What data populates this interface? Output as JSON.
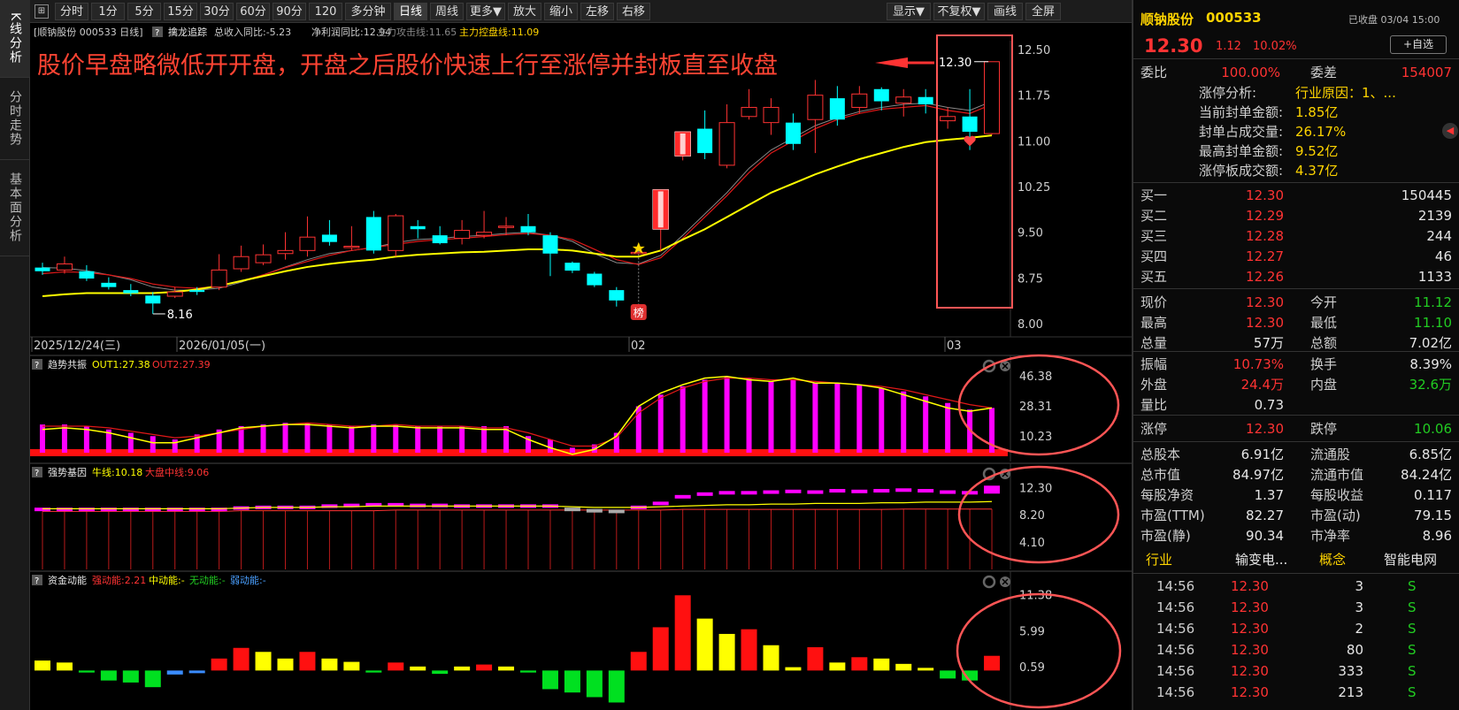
{
  "leftnav": [
    "K线分析",
    "分时走势",
    "基本面分析"
  ],
  "toolbar": {
    "buttons": [
      "分时",
      "1分",
      "5分",
      "15分",
      "30分",
      "60分",
      "90分",
      "120分",
      "多分钟",
      "日线",
      "周线",
      "更多▼",
      "放大",
      "缩小",
      "左移",
      "右移"
    ],
    "active": "日线",
    "right_buttons": [
      "显示▼",
      "不复权▼",
      "画线",
      "全屏"
    ]
  },
  "main_chart": {
    "info": {
      "stock": "[顺钠股份 000533 日线]",
      "help": "?",
      "indicator_name": "擒龙追踪",
      "item1": "总收入同比:-5.23",
      "item2": "净利润同比:12.94",
      "item3": "主力攻击线:11.65",
      "item4": "主力控盘线:11.09"
    },
    "annotation": "股价早盘略微低开开盘，开盘之后股价快速上行至涨停并封板直至收盘",
    "high_label": "12.30",
    "low_label": "8.16",
    "bang_label": "榜",
    "price_axis": [
      "12.50",
      "11.75",
      "11.00",
      "10.25",
      "9.50",
      "8.75",
      "8.00"
    ],
    "date_axis": [
      "2025/12/24(三)",
      "2026/01/05(一)",
      "02",
      "03"
    ]
  },
  "chart_data": [
    {
      "type": "candlestick",
      "title": "顺钠股份 000533 日线",
      "y_range": [
        8.0,
        12.5
      ],
      "candles": [
        {
          "o": 8.92,
          "c": 8.86,
          "h": 9.0,
          "l": 8.8
        },
        {
          "o": 8.88,
          "c": 8.98,
          "h": 9.1,
          "l": 8.82
        },
        {
          "o": 8.86,
          "c": 8.74,
          "h": 8.96,
          "l": 8.7
        },
        {
          "o": 8.67,
          "c": 8.6,
          "h": 8.76,
          "l": 8.56
        },
        {
          "o": 8.55,
          "c": 8.5,
          "h": 8.65,
          "l": 8.45
        },
        {
          "o": 8.46,
          "c": 8.33,
          "h": 8.52,
          "l": 8.16
        },
        {
          "o": 8.45,
          "c": 8.52,
          "h": 8.6,
          "l": 8.42
        },
        {
          "o": 8.55,
          "c": 8.52,
          "h": 8.6,
          "l": 8.47
        },
        {
          "o": 8.6,
          "c": 8.88,
          "h": 9.14,
          "l": 8.55
        },
        {
          "o": 8.9,
          "c": 9.1,
          "h": 9.28,
          "l": 8.85
        },
        {
          "o": 9.0,
          "c": 9.13,
          "h": 9.3,
          "l": 8.96
        },
        {
          "o": 9.15,
          "c": 9.2,
          "h": 9.5,
          "l": 9.05
        },
        {
          "o": 9.2,
          "c": 9.42,
          "h": 9.76,
          "l": 9.1
        },
        {
          "o": 9.46,
          "c": 9.34,
          "h": 9.7,
          "l": 9.28
        },
        {
          "o": 9.25,
          "c": 9.27,
          "h": 9.6,
          "l": 9.2
        },
        {
          "o": 9.75,
          "c": 9.2,
          "h": 9.85,
          "l": 9.15
        },
        {
          "o": 9.2,
          "c": 9.77,
          "h": 9.8,
          "l": 9.1
        },
        {
          "o": 9.6,
          "c": 9.55,
          "h": 9.7,
          "l": 9.4
        },
        {
          "o": 9.45,
          "c": 9.32,
          "h": 9.6,
          "l": 9.3
        },
        {
          "o": 9.4,
          "c": 9.53,
          "h": 9.7,
          "l": 9.3
        },
        {
          "o": 9.45,
          "c": 9.5,
          "h": 9.85,
          "l": 9.4
        },
        {
          "o": 9.58,
          "c": 9.6,
          "h": 9.75,
          "l": 9.45
        },
        {
          "o": 9.6,
          "c": 9.5,
          "h": 9.8,
          "l": 9.45
        },
        {
          "o": 9.45,
          "c": 9.15,
          "h": 9.5,
          "l": 8.78
        },
        {
          "o": 9.0,
          "c": 8.87,
          "h": 9.02,
          "l": 8.83
        },
        {
          "o": 8.82,
          "c": 8.63,
          "h": 8.85,
          "l": 8.6
        },
        {
          "o": 8.55,
          "c": 8.38,
          "h": 8.6,
          "l": 8.28
        },
        {
          "o": 9.15,
          "c": 9.17,
          "h": 9.18,
          "l": 9.14
        },
        {
          "o": 9.55,
          "c": 10.2,
          "h": 10.2,
          "l": 9.18
        },
        {
          "o": 10.75,
          "c": 11.15,
          "h": 11.15,
          "l": 10.68
        },
        {
          "o": 11.2,
          "c": 10.8,
          "h": 11.5,
          "l": 10.7
        },
        {
          "o": 10.6,
          "c": 11.3,
          "h": 11.6,
          "l": 10.55
        },
        {
          "o": 11.4,
          "c": 11.55,
          "h": 11.85,
          "l": 11.35
        },
        {
          "o": 11.3,
          "c": 11.55,
          "h": 11.7,
          "l": 11.1
        },
        {
          "o": 11.3,
          "c": 10.95,
          "h": 11.45,
          "l": 10.85
        },
        {
          "o": 11.35,
          "c": 11.75,
          "h": 12.0,
          "l": 10.8
        },
        {
          "o": 11.7,
          "c": 11.35,
          "h": 11.9,
          "l": 11.25
        },
        {
          "o": 11.55,
          "c": 11.77,
          "h": 11.9,
          "l": 11.45
        },
        {
          "o": 11.85,
          "c": 11.65,
          "h": 11.88,
          "l": 11.5
        },
        {
          "o": 11.62,
          "c": 11.72,
          "h": 11.85,
          "l": 11.4
        },
        {
          "o": 11.72,
          "c": 11.6,
          "h": 11.85,
          "l": 11.45
        },
        {
          "o": 11.33,
          "c": 11.4,
          "h": 11.55,
          "l": 11.2
        },
        {
          "o": 11.4,
          "c": 11.15,
          "h": 11.85,
          "l": 10.85
        },
        {
          "o": 11.12,
          "c": 12.3,
          "h": 12.3,
          "l": 11.1
        }
      ],
      "ma_gray": [
        8.92,
        8.91,
        8.87,
        8.8,
        8.72,
        8.6,
        8.55,
        8.55,
        8.58,
        8.68,
        8.8,
        8.93,
        9.05,
        9.15,
        9.2,
        9.25,
        9.33,
        9.38,
        9.4,
        9.43,
        9.45,
        9.48,
        9.5,
        9.45,
        9.35,
        9.15,
        9.0,
        8.98,
        9.12,
        9.45,
        9.8,
        10.15,
        10.55,
        10.85,
        11.05,
        11.25,
        11.38,
        11.48,
        11.55,
        11.6,
        11.62,
        11.55,
        11.5,
        11.65
      ],
      "ma_red": [
        8.82,
        8.85,
        8.84,
        8.8,
        8.74,
        8.65,
        8.6,
        8.58,
        8.62,
        8.7,
        8.8,
        8.92,
        9.02,
        9.12,
        9.2,
        9.25,
        9.3,
        9.35,
        9.38,
        9.4,
        9.43,
        9.46,
        9.48,
        9.45,
        9.38,
        9.22,
        9.05,
        8.97,
        9.08,
        9.4,
        9.75,
        10.1,
        10.48,
        10.8,
        11.0,
        11.2,
        11.35,
        11.45,
        11.52,
        11.55,
        11.58,
        11.5,
        11.45,
        11.6
      ],
      "ma_yellow": [
        8.45,
        8.48,
        8.5,
        8.5,
        8.5,
        8.5,
        8.52,
        8.56,
        8.62,
        8.7,
        8.78,
        8.86,
        8.93,
        8.98,
        9.02,
        9.05,
        9.1,
        9.13,
        9.15,
        9.17,
        9.18,
        9.2,
        9.22,
        9.22,
        9.2,
        9.15,
        9.1,
        9.1,
        9.2,
        9.38,
        9.55,
        9.75,
        9.95,
        10.15,
        10.3,
        10.45,
        10.58,
        10.7,
        10.8,
        10.9,
        10.98,
        11.02,
        11.05,
        11.09
      ]
    },
    {
      "type": "bar",
      "title": "趋势共振",
      "help": "?",
      "out1": "OUT1:27.38",
      "out2": "OUT2:27.39",
      "axis": [
        "46.38",
        "28.31",
        "10.23"
      ],
      "y_range": [
        0,
        48
      ],
      "values": [
        17,
        17,
        16,
        14,
        12,
        10,
        8,
        11,
        14,
        16,
        17,
        18,
        18,
        17,
        16,
        17,
        17,
        16,
        16,
        16,
        16,
        16,
        10,
        8,
        3,
        5,
        12,
        28,
        35,
        40,
        44,
        46,
        45,
        43,
        44,
        42,
        42,
        41,
        39,
        37,
        34,
        30,
        26,
        27
      ],
      "line_yellow": [
        14,
        15,
        14,
        12,
        9,
        6,
        6,
        9,
        12,
        15,
        16,
        17,
        17,
        16,
        15,
        16,
        16,
        15,
        15,
        15,
        14,
        14,
        8,
        3,
        -1,
        2,
        10,
        28,
        36,
        41,
        45,
        46,
        44,
        43,
        45,
        42,
        42,
        41,
        39,
        35,
        31,
        27,
        25,
        27
      ],
      "line_red": [
        16,
        16,
        16,
        15,
        13,
        11,
        9,
        10,
        12,
        14,
        16,
        17,
        18,
        17,
        16,
        16,
        17,
        16,
        16,
        16,
        15,
        15,
        12,
        8,
        4,
        4,
        9,
        24,
        33,
        39,
        43,
        45,
        45,
        44,
        44,
        43,
        42,
        41,
        40,
        38,
        35,
        32,
        29,
        27
      ]
    },
    {
      "type": "bar",
      "title": "强势基因",
      "help": "?",
      "l1": "牛线:10.18",
      "l2": "大盘中线:9.06",
      "axis": [
        "12.30",
        "8.20",
        "4.10"
      ],
      "y_range": [
        0,
        13
      ],
      "values": [
        9.0,
        9.0,
        9.0,
        9.0,
        9.0,
        9.0,
        9.0,
        9.0,
        9.0,
        9.2,
        9.3,
        9.3,
        9.3,
        9.5,
        9.6,
        9.7,
        9.7,
        9.6,
        9.6,
        9.5,
        9.5,
        9.5,
        9.5,
        9.5,
        9.0,
        8.8,
        8.7,
        9.3,
        9.9,
        10.9,
        11.3,
        11.5,
        11.5,
        11.6,
        11.7,
        11.6,
        11.8,
        11.7,
        11.8,
        11.9,
        11.8,
        11.6,
        11.5,
        12.3
      ],
      "bull_line": [
        9.1,
        9.1,
        9.1,
        9.1,
        9.1,
        9.1,
        9.1,
        9.1,
        9.1,
        9.2,
        9.3,
        9.3,
        9.3,
        9.4,
        9.4,
        9.5,
        9.5,
        9.5,
        9.5,
        9.5,
        9.5,
        9.5,
        9.5,
        9.5,
        9.4,
        9.3,
        9.3,
        9.3,
        9.4,
        9.5,
        9.6,
        9.7,
        9.7,
        9.8,
        9.8,
        9.9,
        9.9,
        9.9,
        10.0,
        10.0,
        10.1,
        10.1,
        10.1,
        10.18
      ],
      "market_line": [
        8.7,
        8.7,
        8.7,
        8.7,
        8.7,
        8.7,
        8.7,
        8.7,
        8.7,
        8.8,
        8.8,
        8.8,
        8.8,
        8.8,
        8.8,
        8.8,
        8.9,
        8.9,
        8.9,
        8.9,
        8.9,
        8.9,
        8.9,
        8.9,
        8.9,
        8.9,
        8.9,
        8.9,
        8.9,
        9.0,
        9.0,
        9.0,
        9.0,
        9.0,
        9.0,
        9.0,
        9.0,
        9.0,
        9.0,
        9.05,
        9.05,
        9.05,
        9.06,
        9.06
      ]
    },
    {
      "type": "bar",
      "title": "资金动能",
      "help": "?",
      "l1": "强动能:2.21",
      "l2": "中动能:-",
      "l3": "无动能:-",
      "l4": "弱动能:-",
      "axis": [
        "11.38",
        "5.99",
        "0.59"
      ],
      "y_range": [
        -5,
        12
      ],
      "values": [
        1.5,
        1.2,
        -0.3,
        -1.5,
        -1.8,
        -2.5,
        -0.6,
        -0.4,
        1.8,
        3.4,
        2.8,
        1.8,
        2.8,
        1.8,
        1.3,
        -0.3,
        1.2,
        0.6,
        -0.5,
        0.6,
        0.9,
        0.6,
        -0.3,
        -2.8,
        -3.3,
        -4.0,
        -4.8,
        2.8,
        6.5,
        11.3,
        7.8,
        5.5,
        6.2,
        3.8,
        0.5,
        3.5,
        1.2,
        2.0,
        1.8,
        1.0,
        0.4,
        -1.2,
        -1.5,
        2.21
      ],
      "colors": [
        "yellow",
        "yellow",
        "green",
        "green",
        "green",
        "green",
        "blue",
        "blue",
        "red",
        "red",
        "yellow",
        "yellow",
        "red",
        "yellow",
        "yellow",
        "green",
        "red",
        "yellow",
        "green",
        "yellow",
        "red",
        "yellow",
        "green",
        "green",
        "green",
        "green",
        "green",
        "red",
        "red",
        "red",
        "yellow",
        "yellow",
        "red",
        "yellow",
        "yellow",
        "red",
        "yellow",
        "red",
        "yellow",
        "yellow",
        "yellow",
        "green",
        "green",
        "red"
      ]
    }
  ],
  "right_panel": {
    "name": "顺钠股份",
    "code": "000533",
    "status": "已收盘 03/04 15:00",
    "price": "12.30",
    "change": "1.12",
    "pct": "10.02%",
    "add_btn": "+自选",
    "webi_label": "委比",
    "webi": "100.00%",
    "weicha_label": "委差",
    "weicha": "154007",
    "zt": [
      {
        "k": "涨停分析:",
        "v": "行业原因：1、..."
      },
      {
        "k": "当前封单金额:",
        "v": "1.85亿"
      },
      {
        "k": "封单占成交量:",
        "v": "26.17%"
      },
      {
        "k": "最高封单金额:",
        "v": "9.52亿"
      },
      {
        "k": "涨停板成交额:",
        "v": "4.37亿"
      }
    ],
    "buy": [
      {
        "k": "买一",
        "p": "12.30",
        "v": "150445"
      },
      {
        "k": "买二",
        "p": "12.29",
        "v": "2139"
      },
      {
        "k": "买三",
        "p": "12.28",
        "v": "244"
      },
      {
        "k": "买四",
        "p": "12.27",
        "v": "46"
      },
      {
        "k": "买五",
        "p": "12.26",
        "v": "1133"
      }
    ],
    "stats1": [
      {
        "k1": "现价",
        "v1": "12.30",
        "c1": "red",
        "k2": "今开",
        "v2": "11.12",
        "c2": "green"
      },
      {
        "k1": "最高",
        "v1": "12.30",
        "c1": "red",
        "k2": "最低",
        "v2": "11.10",
        "c2": "green"
      },
      {
        "k1": "总量",
        "v1": "57万",
        "c1": "white",
        "k2": "总额",
        "v2": "7.02亿",
        "c2": "white"
      }
    ],
    "stats2": [
      {
        "k1": "振幅",
        "v1": "10.73%",
        "c1": "red",
        "k2": "换手",
        "v2": "8.39%",
        "c2": "white"
      },
      {
        "k1": "外盘",
        "v1": "24.4万",
        "c1": "red",
        "k2": "内盘",
        "v2": "32.6万",
        "c2": "green"
      },
      {
        "k1": "量比",
        "v1": "0.73",
        "c1": "white",
        "k2": "",
        "v2": "",
        "c2": "white"
      }
    ],
    "limit": {
      "k1": "涨停",
      "v1": "12.30",
      "k2": "跌停",
      "v2": "10.06"
    },
    "stats3": [
      {
        "k1": "总股本",
        "v1": "6.91亿",
        "k2": "流通股",
        "v2": "6.85亿"
      },
      {
        "k1": "总市值",
        "v1": "84.97亿",
        "k2": "流通市值",
        "v2": "84.24亿"
      },
      {
        "k1": "每股净资",
        "v1": "1.37",
        "k2": "每股收益",
        "v2": "0.117"
      },
      {
        "k1": "市盈(TTM)",
        "v1": "82.27",
        "k2": "市盈(动)",
        "v2": "79.15"
      },
      {
        "k1": "市盈(静)",
        "v1": "90.34",
        "k2": "市净率",
        "v2": "8.96"
      }
    ],
    "industry_label": "行业",
    "industry": "输变电...",
    "concept_label": "概念",
    "concept": "智能电网",
    "ticks": [
      {
        "t": "14:56",
        "p": "12.30",
        "v": "3",
        "s": "S"
      },
      {
        "t": "14:56",
        "p": "12.30",
        "v": "3",
        "s": "S"
      },
      {
        "t": "14:56",
        "p": "12.30",
        "v": "2",
        "s": "S"
      },
      {
        "t": "14:56",
        "p": "12.30",
        "v": "80",
        "s": "S"
      },
      {
        "t": "14:56",
        "p": "12.30",
        "v": "333",
        "s": "S"
      },
      {
        "t": "14:56",
        "p": "12.30",
        "v": "213",
        "s": "S"
      }
    ],
    "colors": {
      "up": "#ff3333",
      "down": "#22cc22",
      "cyan": "#00ffff",
      "magenta": "#ff00ff",
      "yellow": "#ffff00"
    }
  }
}
